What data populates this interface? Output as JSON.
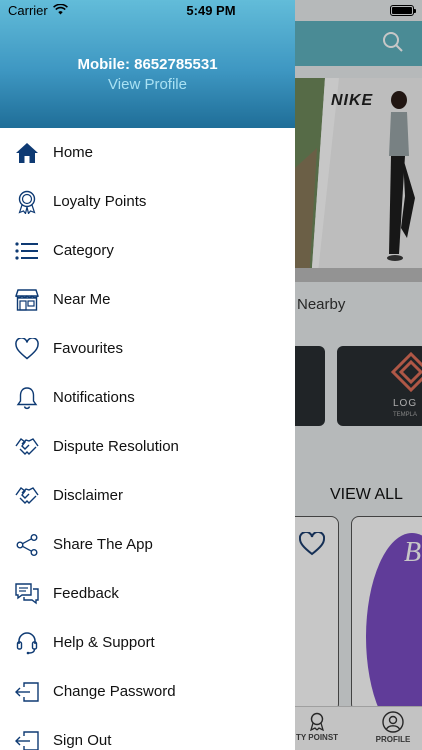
{
  "status_bar": {
    "carrier": "Carrier",
    "time": "5:49 PM"
  },
  "drawer": {
    "mobile": "Mobile: 8652785531",
    "view_profile": "View Profile",
    "items": [
      {
        "label": "Home",
        "icon": "home-icon"
      },
      {
        "label": "Loyalty Points",
        "icon": "award-ribbon-icon"
      },
      {
        "label": "Category",
        "icon": "list-icon"
      },
      {
        "label": "Near Me",
        "icon": "store-icon"
      },
      {
        "label": "Favourites",
        "icon": "heart-icon"
      },
      {
        "label": "Notifications",
        "icon": "bell-icon"
      },
      {
        "label": "Dispute Resolution",
        "icon": "handshake-icon"
      },
      {
        "label": "Disclaimer",
        "icon": "handshake-icon"
      },
      {
        "label": "Share The App",
        "icon": "share-icon"
      },
      {
        "label": "Feedback",
        "icon": "chat-bubbles-icon"
      },
      {
        "label": "Help & Support",
        "icon": "headset-icon"
      },
      {
        "label": "Change Password",
        "icon": "sign-out-icon"
      },
      {
        "label": "Sign Out",
        "icon": "sign-out-icon"
      }
    ]
  },
  "background": {
    "banner_brand": "NIKE",
    "section_nearby": "Nearby",
    "logo_text": "LOG",
    "logo_subtext": "TEMPLA",
    "view_all": "VIEW ALL",
    "tabs": [
      {
        "label": "TY POINST"
      },
      {
        "label": "PROFILE"
      }
    ]
  },
  "colors": {
    "header_top": "#62bcd9",
    "header_bottom": "#1f6e98",
    "icon_color": "#0e3a73",
    "app_header": "#5fb3bf"
  }
}
